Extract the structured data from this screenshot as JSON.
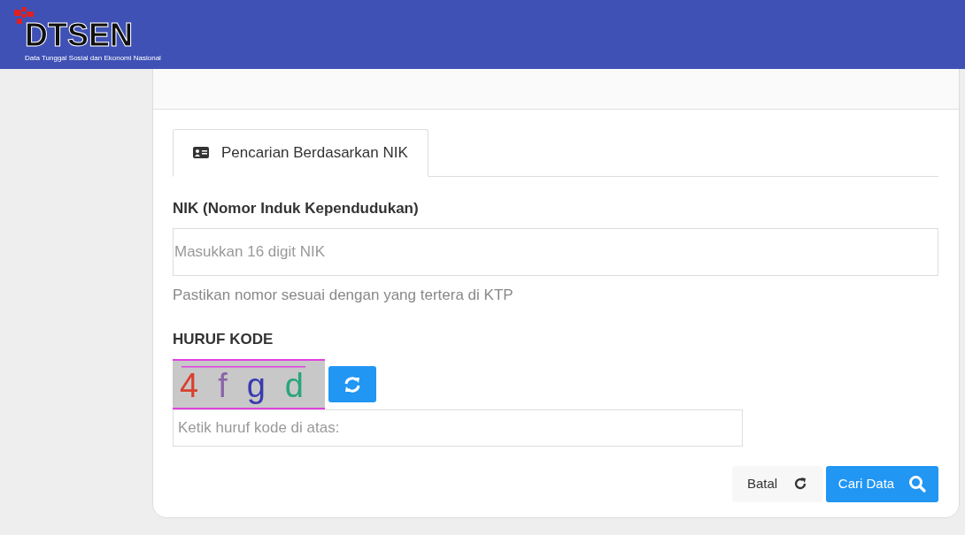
{
  "navbar": {
    "logo_text": "DTSEN",
    "logo_subtitle": "Data Tunggal Sosial dan Ekonomi Nasional"
  },
  "tabs": [
    {
      "label": "Pencarian Berdasarkan NIK",
      "selected": true
    }
  ],
  "nik_field": {
    "label": "NIK (Nomor Induk Kependudukan)",
    "placeholder": "Masukkan 16 digit NIK",
    "help": "Pastikan nomor sesuai dengan yang tertera di KTP"
  },
  "captcha": {
    "label": "HURUF KODE",
    "characters": [
      {
        "text": "4",
        "color": "#d9402f"
      },
      {
        "text": "f",
        "color": "#8a66a8"
      },
      {
        "text": "g",
        "color": "#3a3ab0"
      },
      {
        "text": "d",
        "color": "#2aa57a"
      }
    ],
    "placeholder": "Ketik huruf kode di atas:"
  },
  "buttons": [
    {
      "label": "Batal",
      "kind": "reset"
    },
    {
      "label": "Cari Data",
      "kind": "search"
    }
  ]
}
